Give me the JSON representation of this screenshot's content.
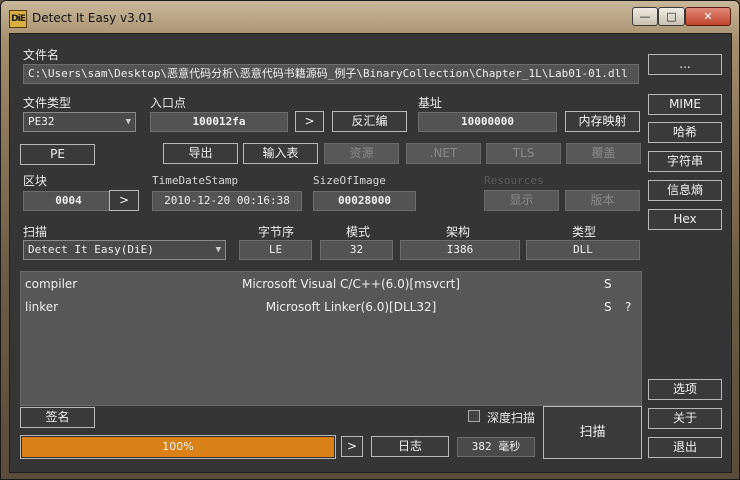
{
  "window": {
    "title": "Detect It Easy v3.01",
    "icon_text": "DiE",
    "controls": {
      "minimize": "—",
      "maximize": "□",
      "close": "✕"
    }
  },
  "file": {
    "label": "文件名",
    "path": "C:\\Users\\sam\\Desktop\\恶意代码分析\\恶意代码书籍源码_例子\\BinaryCollection\\Chapter_1L\\Lab01-01.dll",
    "browse_label": "..."
  },
  "file_type": {
    "label": "文件类型",
    "value": "PE32"
  },
  "entry_point": {
    "label": "入口点",
    "value": "100012fa",
    "go_label": ">",
    "disasm_label": "反汇编"
  },
  "base": {
    "label": "基址",
    "value": "10000000",
    "memmap_label": "内存映射"
  },
  "pe_buttons": {
    "pe": "PE",
    "export": "导出",
    "import": "输入表",
    "resource": "资源",
    "net": ".NET",
    "tls": "TLS",
    "overlay": "覆盖"
  },
  "sections": {
    "label": "区块",
    "value": "0004",
    "go_label": ">"
  },
  "timestamp": {
    "label": "TimeDateStamp",
    "value": "2010-12-20 00:16:38"
  },
  "size_of_image": {
    "label": "SizeOfImage",
    "value": "00028000"
  },
  "resources": {
    "label": "Resources",
    "show_label": "显示",
    "version_label": "版本"
  },
  "scan": {
    "label": "扫描",
    "engine": "Detect It Easy(DiE)",
    "endianness_label": "字节序",
    "endianness": "LE",
    "mode_label": "模式",
    "mode": "32",
    "arch_label": "架构",
    "arch": "I386",
    "type_label": "类型",
    "type": "DLL"
  },
  "results": [
    {
      "type": "compiler",
      "name": "Microsoft Visual C/C++(6.0)[msvcrt]",
      "flag": "S",
      "extra": ""
    },
    {
      "type": "linker",
      "name": "Microsoft Linker(6.0)[DLL32]",
      "flag": "S",
      "extra": "?"
    }
  ],
  "side_buttons": {
    "mime": "MIME",
    "hash": "哈希",
    "strings": "字符串",
    "entropy": "信息熵",
    "hex": "Hex",
    "options": "选项",
    "about": "关于",
    "exit": "退出"
  },
  "bottom": {
    "signatures_label": "签名",
    "deep_scan_label": "深度扫描",
    "deep_scan_checked": false,
    "progress_text": "100%",
    "progress_value": 1.0,
    "next_label": ">",
    "log_label": "日志",
    "time_text": "382 毫秒",
    "scan_label": "扫描"
  },
  "colors": {
    "accent": "#d98016",
    "panel": "#353535",
    "field": "#535353"
  }
}
